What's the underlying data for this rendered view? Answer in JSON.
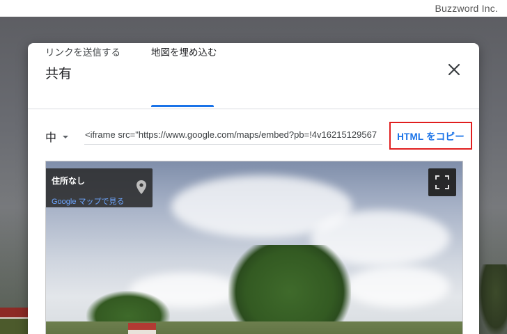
{
  "brand": "Buzzword Inc.",
  "dialog": {
    "title": "共有",
    "tabs": [
      {
        "label": "リンクを送信する",
        "active": false
      },
      {
        "label": "地図を埋め込む",
        "active": true
      }
    ]
  },
  "embed": {
    "size_value": "中",
    "code": "<iframe src=\"https://www.google.com/maps/embed?pb=!4v16215129567",
    "copy_label": "HTML をコピー"
  },
  "preview": {
    "place_name": "住所なし",
    "map_link": "Google マップで見る"
  },
  "icons": {
    "close": "close-icon",
    "dropdown": "caret-down-icon",
    "pin": "map-pin-icon",
    "fullscreen": "fullscreen-icon"
  },
  "colors": {
    "accent": "#1a73e8",
    "highlight_border": "#e01e1e"
  }
}
